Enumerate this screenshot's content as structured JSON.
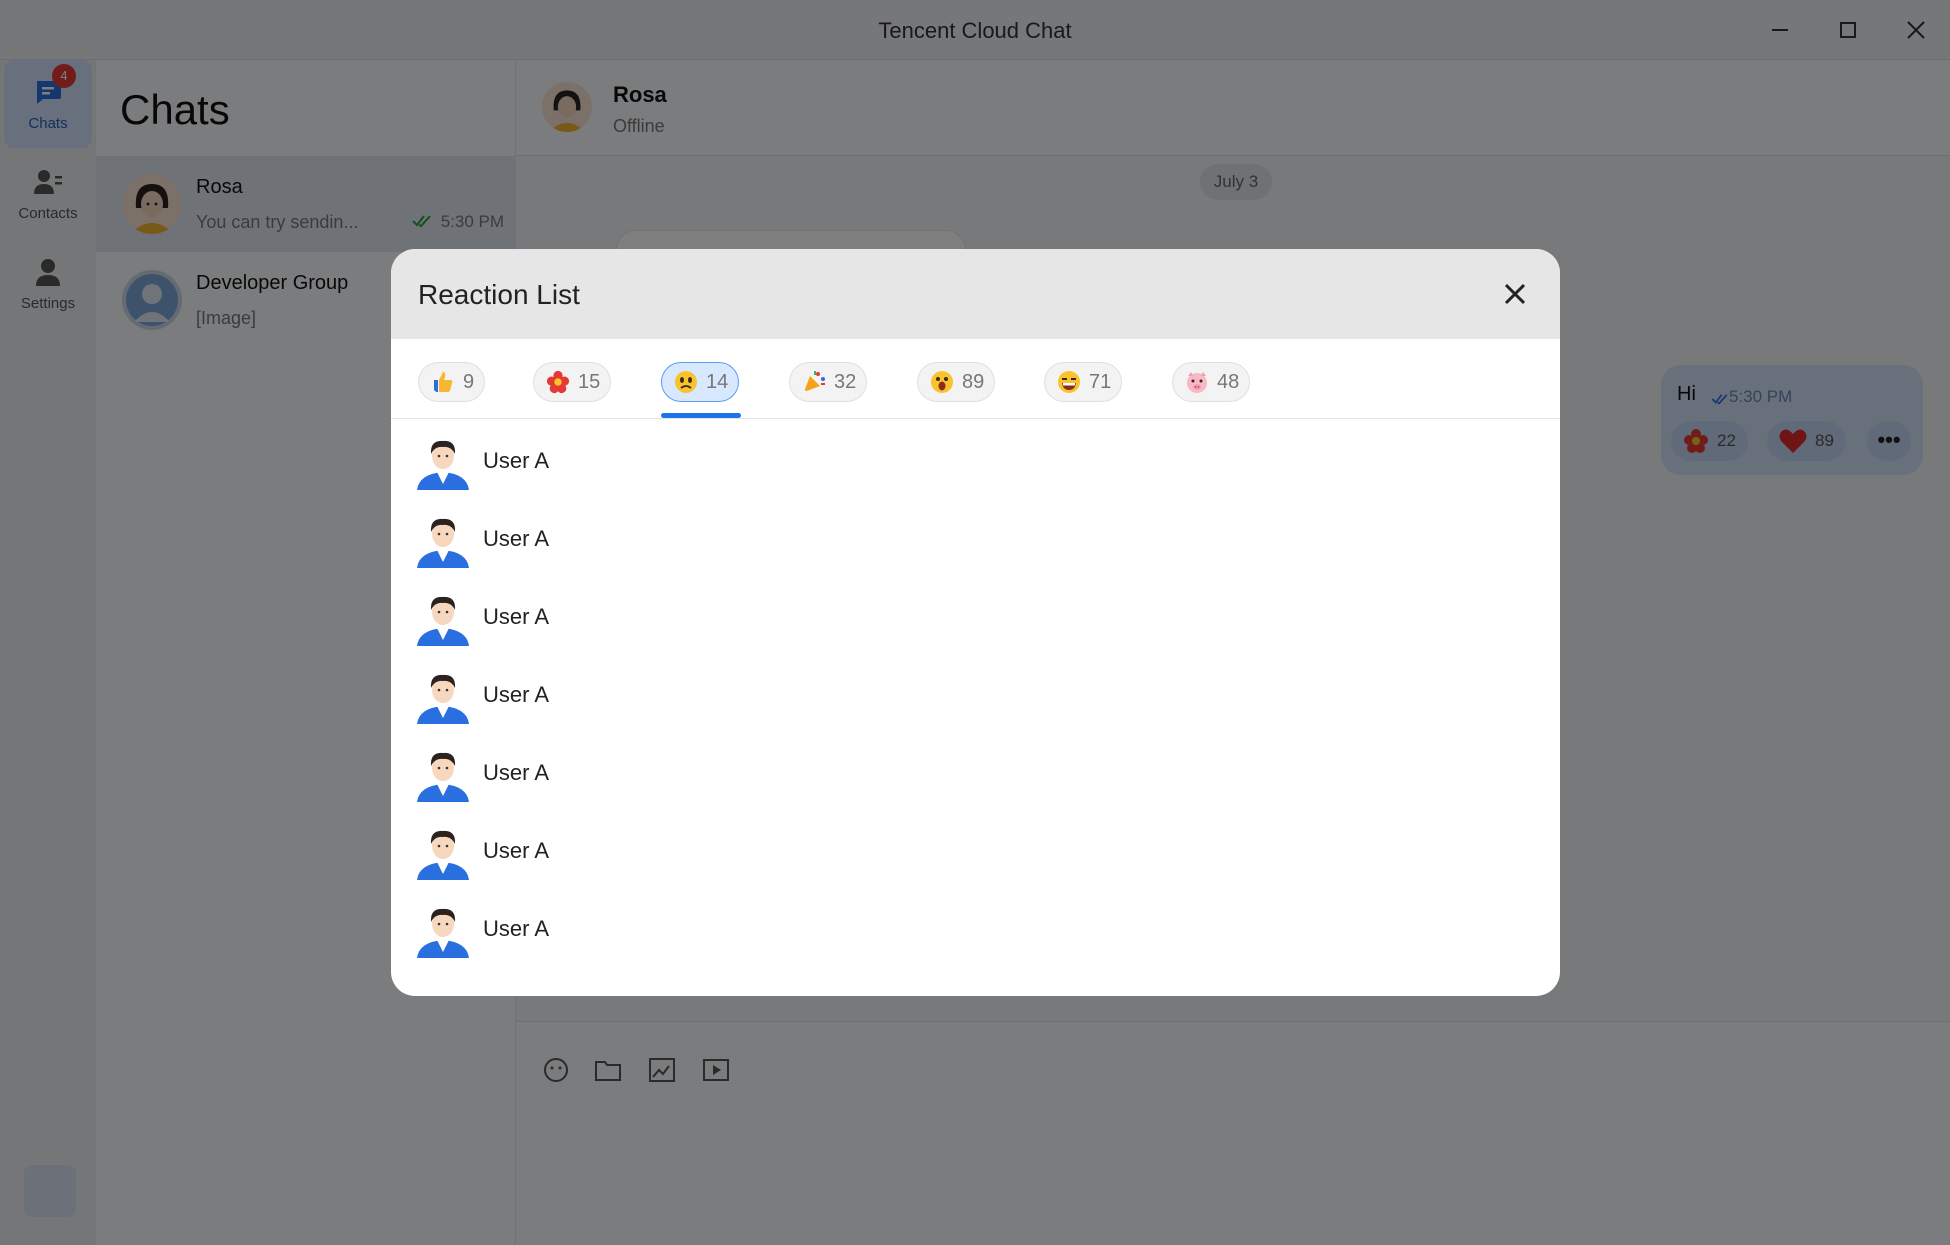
{
  "window": {
    "title": "Tencent Cloud Chat"
  },
  "rail": {
    "items": [
      {
        "label": "Chats",
        "badge": "4"
      },
      {
        "label": "Contacts"
      },
      {
        "label": "Settings"
      }
    ]
  },
  "conversations": {
    "title": "Chats",
    "items": [
      {
        "name": "Rosa",
        "preview": "You can try sendin...",
        "time": "5:30 PM"
      },
      {
        "name": "Developer Group",
        "preview": "[Image]"
      }
    ]
  },
  "chat": {
    "name": "Rosa",
    "status": "Offline",
    "date_chip": "July 3",
    "message": {
      "text": "Hi",
      "time": "5:30 PM",
      "reactions": [
        {
          "icon": "flower-emoji",
          "count": "22"
        },
        {
          "icon": "heart-emoji",
          "count": "89"
        }
      ]
    }
  },
  "modal": {
    "title": "Reaction List",
    "tabs": [
      {
        "icon": "thumbs-up-emoji",
        "count": "9"
      },
      {
        "icon": "flower-emoji",
        "count": "15"
      },
      {
        "icon": "frowning-face-emoji",
        "count": "14"
      },
      {
        "icon": "party-popper-emoji",
        "count": "32"
      },
      {
        "icon": "surprised-face-emoji",
        "count": "89"
      },
      {
        "icon": "tongue-face-emoji",
        "count": "71"
      },
      {
        "icon": "pig-face-emoji",
        "count": "48"
      }
    ],
    "active_tab_index": 2,
    "users": [
      "User A",
      "User A",
      "User A",
      "User A",
      "User A",
      "User A",
      "User A"
    ]
  },
  "colors": {
    "accent": "#1e73e8",
    "badge": "#e53935",
    "overlay": "rgba(0,0,0,0.5)"
  }
}
